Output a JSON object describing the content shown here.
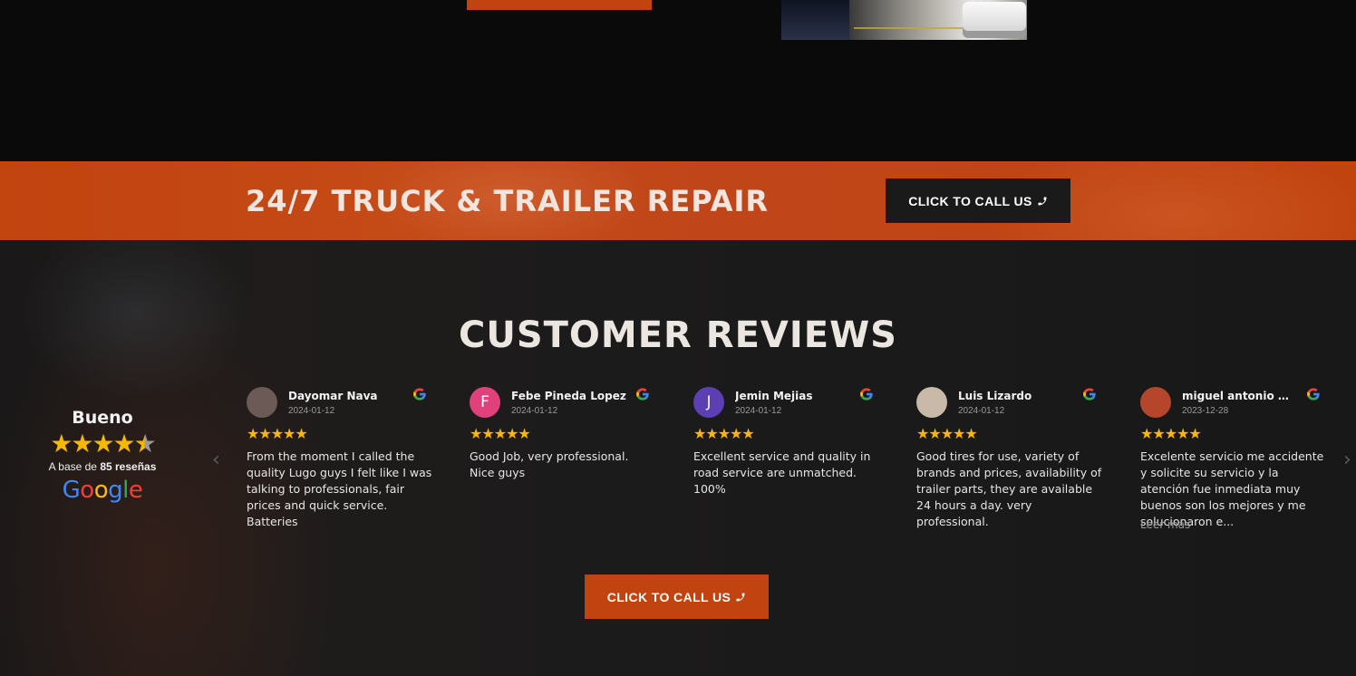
{
  "banner": {
    "title": "24/7 TRUCK & TRAILER REPAIR",
    "call_label": "CLICK TO CALL US"
  },
  "reviews": {
    "title": "CUSTOMER REVIEWS",
    "summary": {
      "rating_word": "Bueno",
      "stars": 4.5,
      "based_prefix": "A base de",
      "count_text": "85 reseñas",
      "provider": "Google"
    },
    "cards": [
      {
        "name": "Dayomar Nava",
        "date": "2024-01-12",
        "stars": "★★★★★",
        "text": "From the moment I called the quality Lugo guys I felt like I was talking to professionals, fair prices and quick service. Batteries",
        "avatar_initial": "",
        "avatar_color": "#6b5a55"
      },
      {
        "name": "Febe Pineda Lopez",
        "date": "2024-01-12",
        "stars": "★★★★★",
        "text": "Good Job, very professional. Nice guys",
        "avatar_initial": "F",
        "avatar_color": "#e0417a"
      },
      {
        "name": "Jemin Mejias",
        "date": "2024-01-12",
        "stars": "★★★★★",
        "text": "Excellent service and quality in road service are unmatched. 100%",
        "avatar_initial": "J",
        "avatar_color": "#5b3fb3"
      },
      {
        "name": "Luis Lizardo",
        "date": "2024-01-12",
        "stars": "★★★★★",
        "text": "Good tires for use, variety of brands and prices, availability of trailer parts, they are available 24 hours a day. very professional.",
        "avatar_initial": "",
        "avatar_color": "#c9b9a8"
      },
      {
        "name": "miguel antonio moril...",
        "date": "2023-12-28",
        "stars": "★★★★★",
        "text": "Excelente servicio me accidente y solicite su servicio y la atención fue inmediata muy buenos son los mejores y me solucionaron e...",
        "avatar_initial": "",
        "avatar_color": "#b5452b",
        "more": "Leer más"
      }
    ],
    "call_label": "CLICK TO CALL US"
  },
  "colors": {
    "accent": "#c1430f",
    "dark": "#1a1a1a",
    "star": "#f6b800"
  }
}
